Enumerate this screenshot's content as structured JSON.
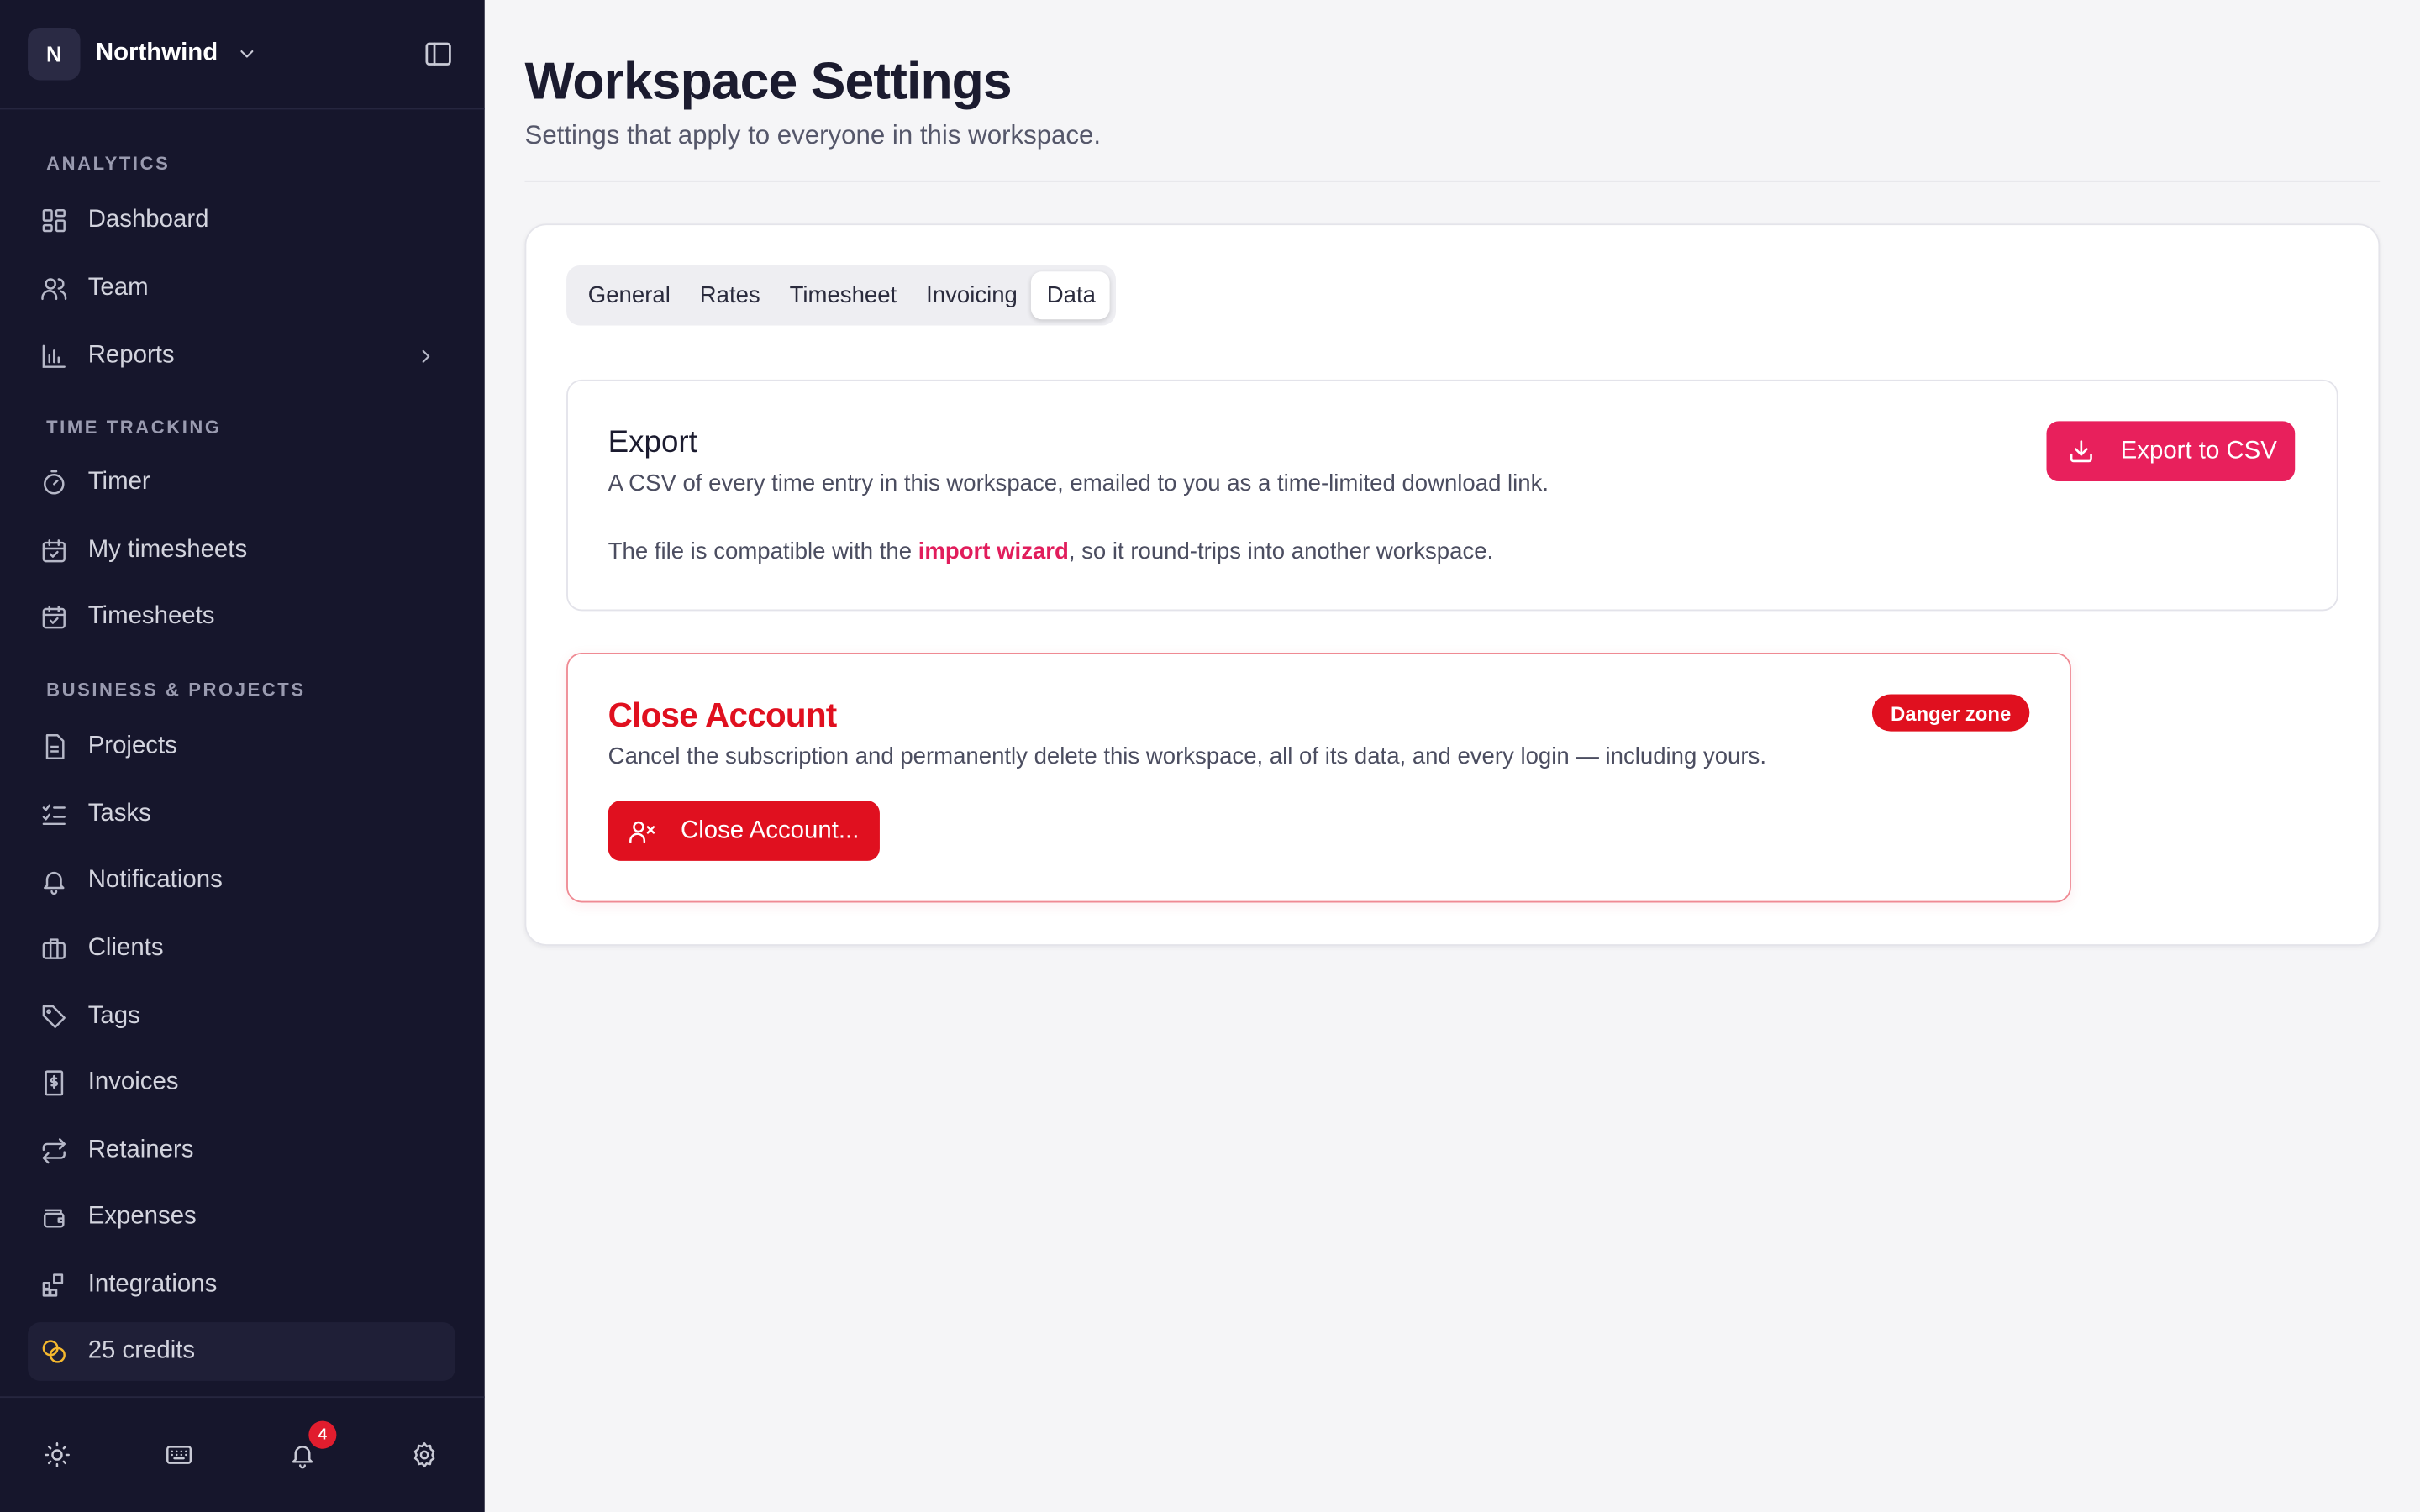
{
  "workspace": {
    "initial": "N",
    "name": "Northwind"
  },
  "sidebar": {
    "sections": [
      {
        "label": "ANALYTICS"
      },
      {
        "label": "TIME TRACKING"
      },
      {
        "label": "BUSINESS & PROJECTS"
      }
    ],
    "items": [
      {
        "label": "Dashboard",
        "icon": "dashboard-icon"
      },
      {
        "label": "Team",
        "icon": "users-icon"
      },
      {
        "label": "Reports",
        "icon": "bar-chart-icon"
      },
      {
        "label": "Timer",
        "icon": "stopwatch-icon"
      },
      {
        "label": "My timesheets",
        "icon": "calendar-check-icon"
      },
      {
        "label": "Timesheets",
        "icon": "calendar-check-icon"
      },
      {
        "label": "Projects",
        "icon": "file-icon"
      },
      {
        "label": "Tasks",
        "icon": "checklist-icon"
      },
      {
        "label": "Notifications",
        "icon": "bell-icon"
      },
      {
        "label": "Clients",
        "icon": "briefcase-icon"
      },
      {
        "label": "Tags",
        "icon": "tag-icon"
      },
      {
        "label": "Invoices",
        "icon": "invoice-icon"
      },
      {
        "label": "Retainers",
        "icon": "repeat-icon"
      },
      {
        "label": "Expenses",
        "icon": "wallet-icon"
      },
      {
        "label": "Integrations",
        "icon": "grid-plus-icon"
      },
      {
        "label": "25 credits",
        "icon": "coins-icon"
      }
    ],
    "footer": {
      "notification_count": "4"
    }
  },
  "page": {
    "title": "Workspace Settings",
    "subtitle": "Settings that apply to everyone in this workspace."
  },
  "tabs": [
    "General",
    "Rates",
    "Timesheet",
    "Invoicing",
    "Data"
  ],
  "active_tab": "Data",
  "export": {
    "title": "Export",
    "description": "A CSV of every time entry in this workspace, emailed to you as a time-limited download link.",
    "note_prefix": "The file is compatible with the ",
    "note_link": "import wizard",
    "note_suffix": ", so it round-trips into another workspace.",
    "button_label": "Export to CSV"
  },
  "danger": {
    "title": "Close Account",
    "badge": "Danger zone",
    "description": "Cancel the subscription and permanently delete this workspace, all of its data, and every login — including yours.",
    "button_label": "Close Account..."
  },
  "colors": {
    "sidebar_bg": "#16162c",
    "accent": "#e8205c",
    "danger": "#e0101f",
    "credits_icon": "#f5b82e"
  }
}
